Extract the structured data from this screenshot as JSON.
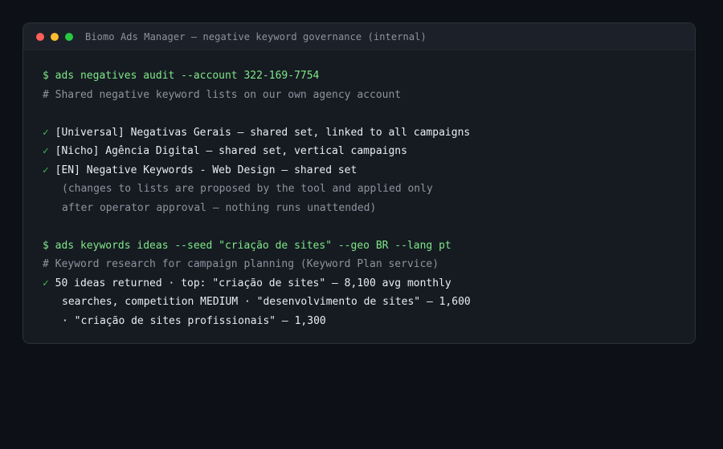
{
  "window": {
    "title": "Biomo Ads Manager — negative keyword governance (internal)"
  },
  "terminal": {
    "cmd1": "$ ads negatives audit --account 322-169-7754",
    "comment1": "# Shared negative keyword lists on our own agency account",
    "check_mark": "✓",
    "list1": "[Universal] Negativas Gerais — shared set, linked to all campaigns",
    "list2": "[Nicho] Agência Digital — shared set, vertical campaigns",
    "list3": "[EN] Negative Keywords - Web Design — shared set",
    "note1": "(changes to lists are proposed by the tool and applied only",
    "note2": "after operator approval — nothing runs unattended)",
    "cmd2": "$ ads keywords ideas --seed \"criação de sites\" --geo BR --lang pt",
    "comment2": "# Keyword research for campaign planning (Keyword Plan service)",
    "result1": "50 ideas returned · top: \"criação de sites\" — 8,100 avg monthly",
    "result2": "searches, competition MEDIUM · \"desenvolvimento de sites\" — 1,600",
    "result3": "· \"criação de sites profissionais\" — 1,300"
  },
  "colors": {
    "background": "#0d1117",
    "window": "#161b22",
    "command": "#7ee787",
    "comment": "#8b949e",
    "check": "#3fb950"
  }
}
